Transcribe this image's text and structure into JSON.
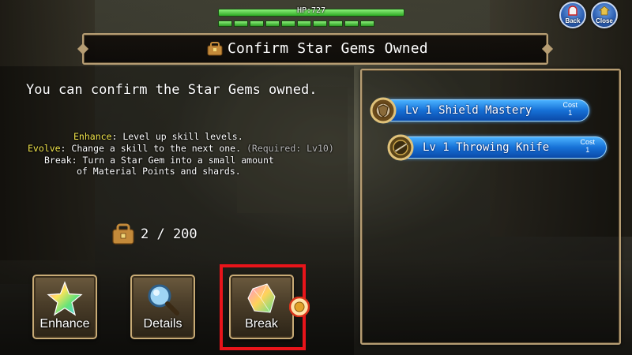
{
  "hud": {
    "hp_label": "HP:727",
    "hp_fraction": 1.0,
    "hp_segments": 10
  },
  "nav": {
    "back_label": "Back",
    "close_label": "Close"
  },
  "title": "Confirm Star Gems Owned",
  "main": {
    "description": "You can confirm the Star Gems owned.",
    "help": {
      "enhance_key": "Enhance",
      "enhance_text": ": Level up skill levels.",
      "evolve_key": "Evolve",
      "evolve_text": ": Change a skill to the next one.",
      "evolve_req": "(Required: Lv10)",
      "break_text_1": "Break: Turn a Star Gem into a small amount",
      "break_text_2": "of Material Points and shards."
    },
    "count": "2 / 200"
  },
  "actions": {
    "enhance_label": "Enhance",
    "details_label": "Details",
    "break_label": "Break"
  },
  "skills": [
    {
      "name": "Lv 1 Shield Mastery",
      "cost_label": "Cost",
      "cost": "1"
    },
    {
      "name": "Lv 1 Throwing Knife",
      "cost_label": "Cost",
      "cost": "1"
    }
  ],
  "colors": {
    "highlight": "#e8141a",
    "keyword": "#f3e64c",
    "skill_blue": "#1670d6",
    "frame_gold": "#b69d73"
  },
  "icons": {
    "title": "treasure-bag-icon",
    "count": "treasure-bag-icon",
    "enhance": "star-gem-icon",
    "details": "magnifier-icon",
    "break": "crystal-shard-icon",
    "medal": "medal-icon",
    "skill_1": "shield-ring-icon",
    "skill_2": "knife-ring-icon"
  }
}
